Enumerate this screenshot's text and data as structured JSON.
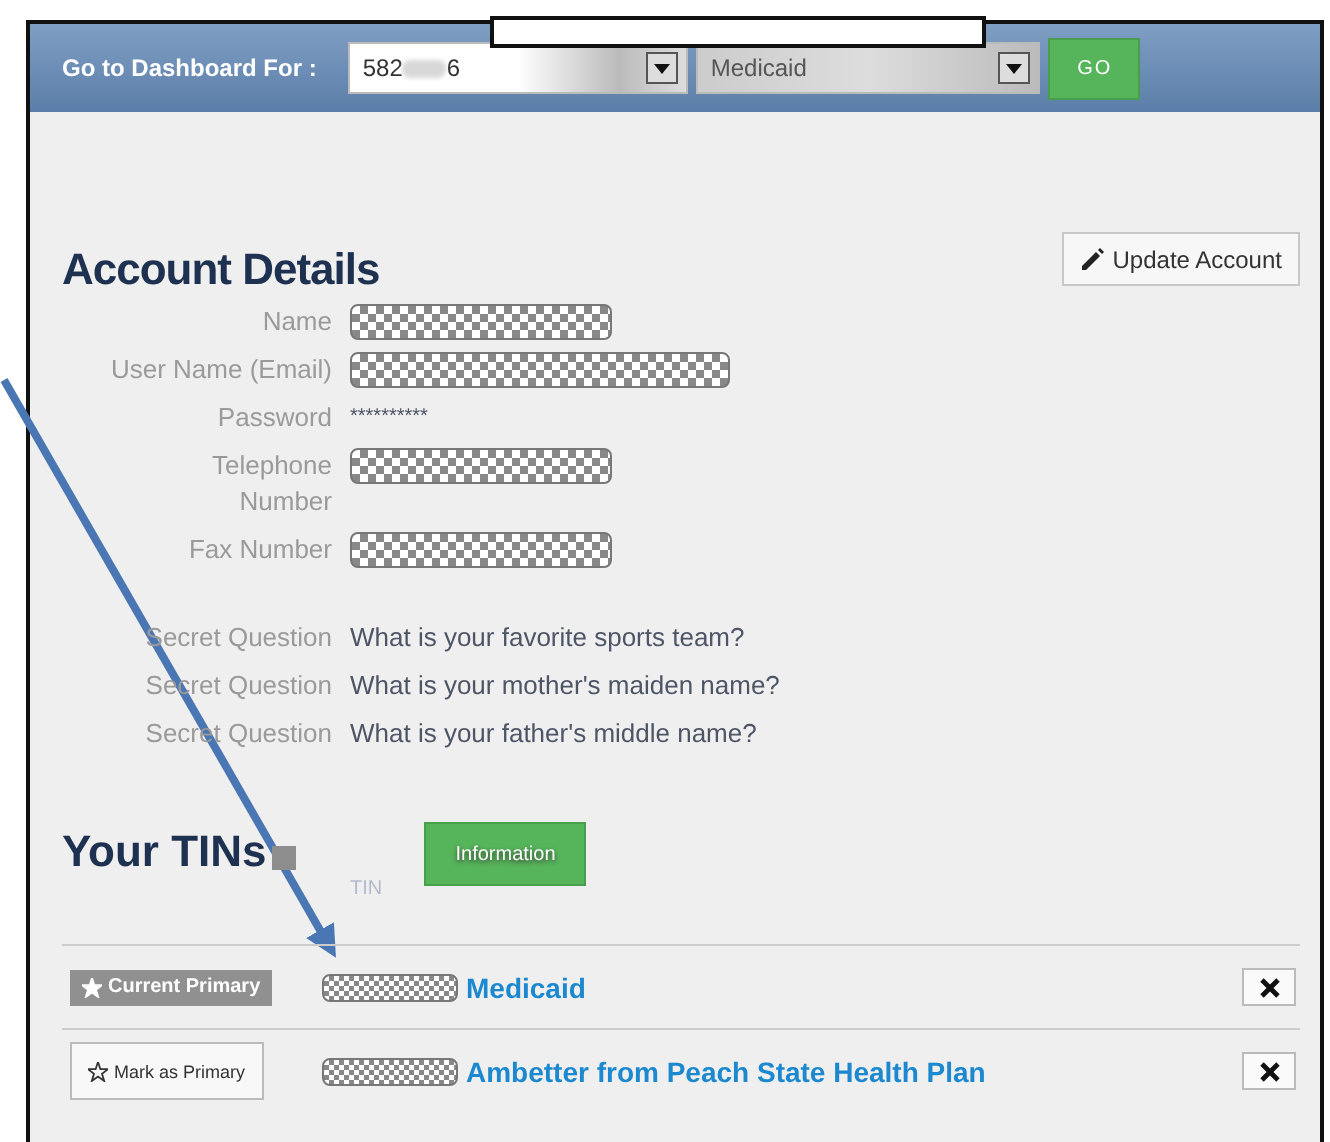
{
  "top_bar": {
    "label": "Go to Dashboard For :",
    "tin_select": {
      "value_start": "582",
      "value_end": "6"
    },
    "plan_select": {
      "value": "Medicaid"
    },
    "go_button": "GO"
  },
  "account": {
    "title": "Account Details",
    "update_button": "Update Account",
    "fields": [
      {
        "label": "Name",
        "kind": "masked"
      },
      {
        "label": "User Name (Email)",
        "kind": "masked_long"
      },
      {
        "label": "Password",
        "kind": "text",
        "value": "**********"
      },
      {
        "label": "Telephone Number",
        "kind": "masked"
      },
      {
        "label": "Fax Number",
        "kind": "masked"
      },
      {
        "label": "Secret Question",
        "kind": "text",
        "value": "What is your favorite sports team?"
      },
      {
        "label": "Secret Question",
        "kind": "text",
        "value": "What is your mother's maiden name?"
      },
      {
        "label": "Secret Question",
        "kind": "text",
        "value": "What is your father's middle name?"
      }
    ]
  },
  "tins": {
    "title": "Your TINs",
    "info_button": "Information",
    "column": "TIN",
    "rows": [
      {
        "primary": true,
        "status": "Current Primary",
        "name": "Medicaid"
      },
      {
        "primary": false,
        "status": "Mark as Primary",
        "name": "Ambetter from Peach State Health Plan"
      }
    ]
  }
}
